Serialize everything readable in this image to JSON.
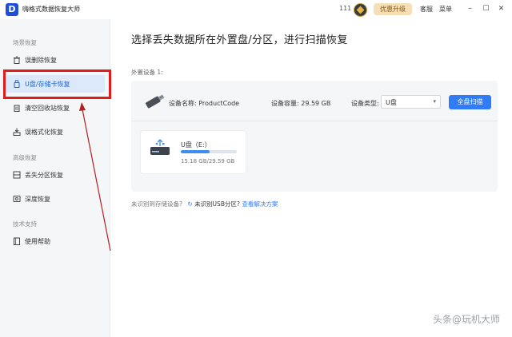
{
  "titlebar": {
    "logo_letter": "D",
    "title": "嗨格式数据恢复大师",
    "count": "111",
    "upgrade": "优惠升级",
    "service": "客服",
    "menu": "菜单",
    "minimize": "–",
    "restore": "☐",
    "close": "✕"
  },
  "sidebar": {
    "sections": [
      {
        "label": "场景恢复",
        "items": [
          {
            "label": "误删除恢复",
            "icon": "trash-restore-icon"
          },
          {
            "label": "U盘/存储卡恢复",
            "icon": "usb-drive-icon",
            "active": true
          },
          {
            "label": "清空回收站恢复",
            "icon": "recycle-bin-icon"
          },
          {
            "label": "误格式化恢复",
            "icon": "format-icon"
          }
        ]
      },
      {
        "label": "高级恢复",
        "items": [
          {
            "label": "丢失分区恢复",
            "icon": "partition-icon"
          },
          {
            "label": "深度恢复",
            "icon": "deep-scan-icon"
          }
        ]
      },
      {
        "label": "技术支持",
        "items": [
          {
            "label": "使用帮助",
            "icon": "help-book-icon"
          }
        ]
      }
    ]
  },
  "main": {
    "title": "选择丢失数据所在外置盘/分区，进行扫描恢复",
    "external_label": "外置设备 1:",
    "device": {
      "name": "设备名称: ProductCode",
      "capacity": "设备容量: 29.59 GB",
      "type_label": "设备类型:",
      "type_value": "U盘",
      "scan_button": "全盘扫描"
    },
    "drive": {
      "name": "U盘（E:）",
      "size": "15.18 GB/29.59 GB",
      "used_fraction": 0.513
    },
    "help": {
      "question": "未识别到存储设备?",
      "spin": "↻",
      "usb_text": "未识别USB分区?",
      "link": "查看解决方案"
    }
  },
  "watermark": "头条@玩机大师",
  "colors": {
    "accent": "#2f7cf6",
    "highlight": "#e21b1b"
  }
}
